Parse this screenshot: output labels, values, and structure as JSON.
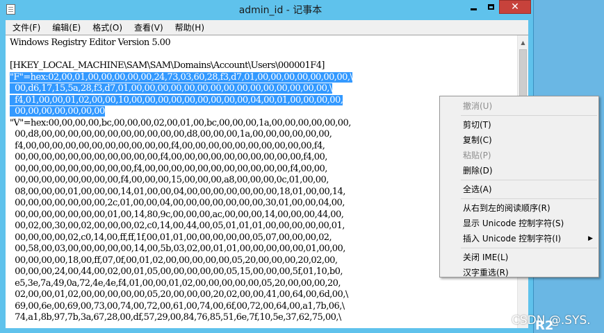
{
  "window": {
    "title": "admin_id - 记事本",
    "close_glyph": "✕"
  },
  "menubar": {
    "items": [
      "文件(F)",
      "编辑(E)",
      "格式(O)",
      "查看(V)",
      "帮助(H)"
    ]
  },
  "editor": {
    "lines": [
      "Windows Registry Editor Version 5.00",
      "",
      "[HKEY_LOCAL_MACHINE\\SAM\\SAM\\Domains\\Account\\Users\\000001F4]",
      "\"F\"=hex:02,00,01,00,00,00,00,00,24,73,03,60,28,f3,d7,01,00,00,00,00,00,00,00,\\",
      "  00,d6,17,15,5a,28,f3,d7,01,00,00,00,00,00,00,00,00,00,00,00,00,00,00,00,\\",
      "  f4,01,00,00,01,02,00,00,10,00,00,00,00,00,00,00,00,00,04,00,01,00,00,00,00,",
      "  00,00,00,00,00,00,00",
      "\"V\"=hex:00,00,00,00,bc,00,00,00,02,00,01,00,bc,00,00,00,1a,00,00,00,00,00,00,",
      "  00,d8,00,00,00,00,00,00,00,00,00,00,00,d8,00,00,00,1a,00,00,00,00,00,00,",
      "  f4,00,00,00,00,00,00,00,00,00,00,00,f4,00,00,00,00,00,00,00,00,00,00,f4,",
      "  00,00,00,00,00,00,00,00,00,00,00,f4,00,00,00,00,00,00,00,00,00,00,f4,00,",
      "  00,00,00,00,00,00,00,00,00,f4,00,00,00,00,00,00,00,00,00,00,00,f4,00,00,",
      "  00,00,00,00,00,00,00,00,f4,00,00,00,15,00,00,00,a8,00,00,00,0c,01,00,00,",
      "  08,00,00,00,01,00,00,00,14,01,00,00,04,00,00,00,00,00,00,00,18,01,00,00,14,",
      "  00,00,00,00,00,00,00,2c,01,00,00,04,00,00,00,00,00,00,00,30,01,00,00,04,00,",
      "  00,00,00,00,00,00,00,01,00,14,80,9c,00,00,00,ac,00,00,00,14,00,00,00,44,00,",
      "  00,02,00,30,00,02,00,00,00,02,c0,14,00,44,00,05,01,01,01,00,00,00,00,00,01,",
      "  00,00,00,00,02,c0,14,00,ff,ff,1f,00,01,01,00,00,00,00,00,05,07,00,00,00,02,",
      "  00,58,00,03,00,00,00,00,00,14,00,5b,03,02,00,01,01,00,00,00,00,00,01,00,00,",
      "  00,00,00,00,18,00,ff,07,0f,00,01,02,00,00,00,00,00,05,20,00,00,00,20,02,00,",
      "  00,00,00,24,00,44,00,02,00,01,05,00,00,00,00,00,05,15,00,00,00,5f,01,10,b0,",
      "  e5,3e,7a,49,0a,72,4e,4e,f4,01,00,00,01,02,00,00,00,00,00,05,20,00,00,00,20,",
      "  02,00,00,01,02,00,00,00,00,00,05,20,00,00,00,20,02,00,00,41,00,64,00,6d,00,\\",
      "  69,00,6e,00,69,00,73,00,74,00,72,00,61,00,74,00,6f,00,72,00,64,00,a1,7b,06,\\",
      "  74,a1,8b,97,7b,3a,67,28,00,df,57,29,00,84,76,85,51,6e,7f,10,5e,37,62,75,00,\\"
    ]
  },
  "context_menu": {
    "items": [
      {
        "label": "撤消(U)",
        "disabled": true
      },
      {
        "sep": true
      },
      {
        "label": "剪切(T)",
        "disabled": false
      },
      {
        "label": "复制(C)",
        "disabled": false
      },
      {
        "label": "粘贴(P)",
        "disabled": true
      },
      {
        "label": "删除(D)",
        "disabled": false
      },
      {
        "sep": true
      },
      {
        "label": "全选(A)",
        "disabled": false
      },
      {
        "sep": true
      },
      {
        "label": "从右到左的阅读顺序(R)",
        "disabled": false
      },
      {
        "label": "显示 Unicode 控制字符(S)",
        "disabled": false
      },
      {
        "label": "插入 Unicode 控制字符(I)",
        "disabled": false,
        "submenu": true,
        "arrow": "▶"
      },
      {
        "sep": true
      },
      {
        "label": "关闭 IME(L)",
        "disabled": false
      },
      {
        "label": "汉字重选(R)",
        "disabled": false
      }
    ]
  },
  "watermark": {
    "text": "CSDN @.SYS.",
    "overlay": "R2"
  }
}
